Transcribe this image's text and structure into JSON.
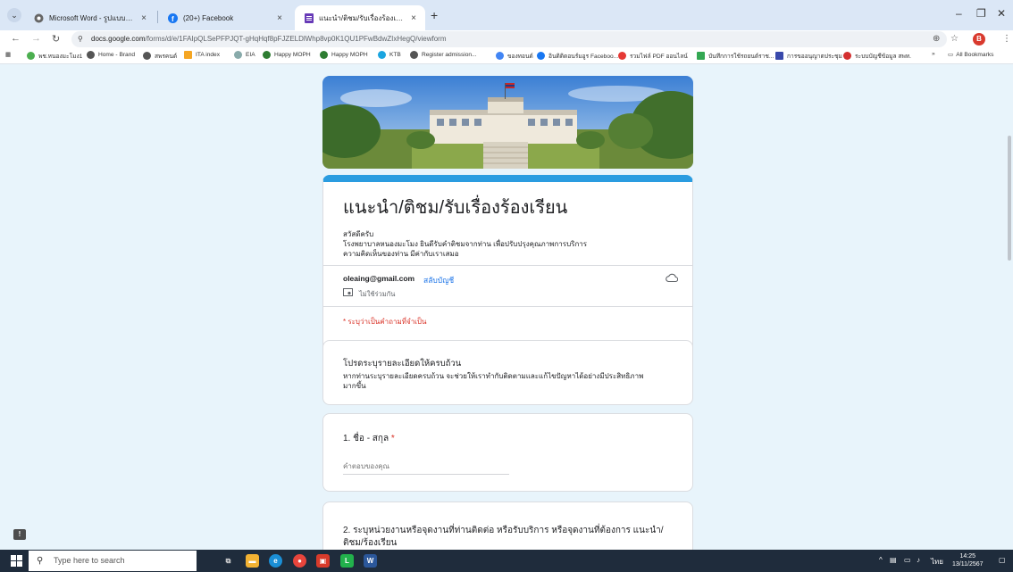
{
  "browser": {
    "tabs": [
      {
        "title": "Microsoft Word - รูปแบบการเสนอ",
        "favicon": "chrome-icon"
      },
      {
        "title": "(20+) Facebook",
        "favicon": "facebook-icon"
      },
      {
        "title": "แนะนำ/ติชม/รับเรื่องร้องเรียน",
        "favicon": "google-forms-icon"
      }
    ],
    "url_domain": "docs.google.com",
    "url_path": "/forms/d/e/1FAIpQLSePFPJQT-gHqHqf8pFJZELDlWhp8vp0K1QU1PFwBdwZIxHegQ/viewform",
    "bookmarks": [
      "พช.หนองมะโมง1",
      "Home - Brand",
      "สพรคนด์",
      "ITA index",
      "EIA",
      "Happy MOPH",
      "Happy MOPH",
      "KTB",
      "Register admission...",
      "ของทอนด์",
      "อินดิดิดอนร์มอูร Faceboo...",
      "รวมไฟล์ PDF ออนไลน์",
      "บันทึกการใช้รถยนต์ราช...",
      "การขออนุญาตประชุม",
      "ระบบบัญชีข้อมูล สพท."
    ],
    "all_bookmarks": "All Bookmarks",
    "profile_initial": "B",
    "colors": {
      "accent": "#2a9ce0",
      "required": "#d93025",
      "link": "#1a73e8"
    }
  },
  "form": {
    "title": "แนะนำ/ติชม/รับเรื่องร้องเรียน",
    "desc_line1": "สวัสดีครับ",
    "desc_line2": "โรงพยาบาลหนองมะโมง ยินดีรับคำติชมจากท่าน เพื่อปรับปรุงคุณภาพการบริการ",
    "desc_line3": "ความคิดเห็นของท่าน มีค่ากับเราเสมอ",
    "account_email": "oleaing@gmail.com",
    "switch_account": "สลับบัญชี",
    "not_shared": "ไม่ใช้ร่วมกัน",
    "required_note": "* ระบุว่าเป็นคำถามที่จำเป็น",
    "section": {
      "title": "โปรดระบุรายละเอียดให้ครบถ้วน",
      "line1": "หากท่านระบุรายละเอียดครบถ้วน จะช่วยให้เราทำกับติดตามและแก้ไขปัญหาได้อย่างมีประสิทธิภาพ",
      "line2": "มากขึ้น"
    },
    "q1": {
      "label": "1. ชื่อ - สกุล",
      "required_mark": "*",
      "placeholder": "คำตอบของคุณ"
    },
    "q2": {
      "label": "2. ระบุหน่วยงานหรือจุดงานที่ท่านติดต่อ หรือรับบริการ หรือจุดงานที่ต้องการ แนะนำ/ติชม/ร้องเรียน"
    }
  },
  "taskbar": {
    "search_placeholder": "Type here to search",
    "language": "ไทย",
    "time": "14:25",
    "date": "13/11/2567"
  }
}
